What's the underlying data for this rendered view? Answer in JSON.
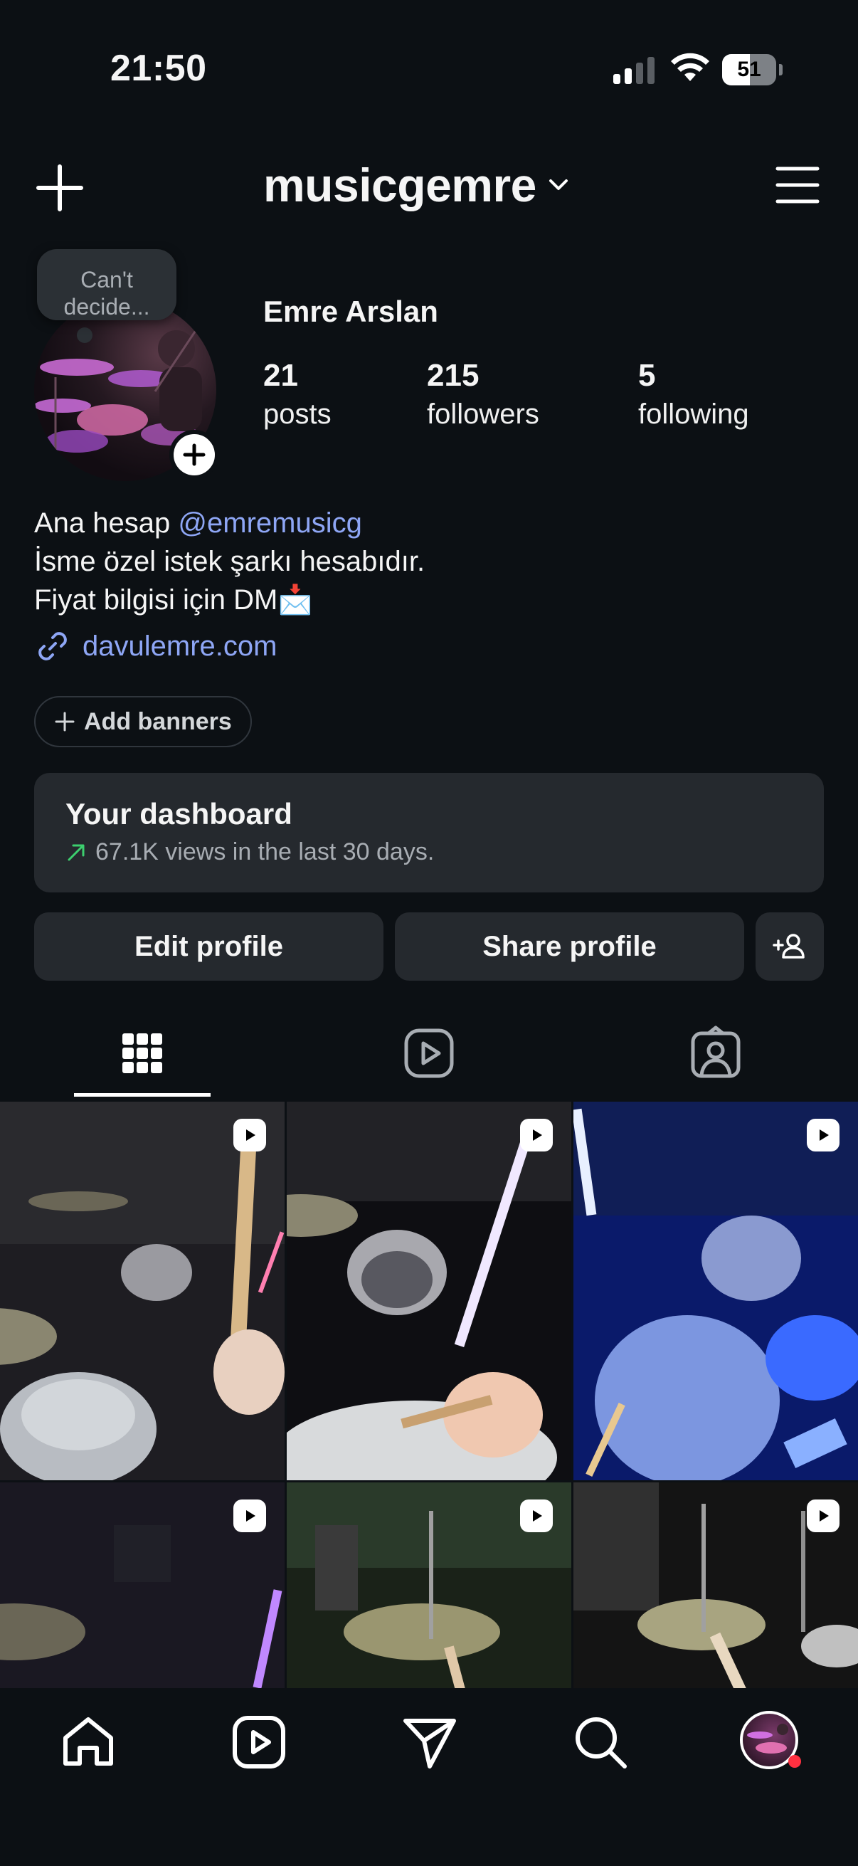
{
  "status_bar": {
    "time": "21:50",
    "battery": "51",
    "battery_level": 0.51,
    "signal_bars": 2
  },
  "header": {
    "username": "musicgemre",
    "icons": [
      "plus-icon",
      "chevron-down-icon",
      "hamburger-menu-icon"
    ]
  },
  "profile": {
    "note": "Can't decide...",
    "full_name": "Emre Arslan",
    "stats": [
      {
        "count": "21",
        "label": "posts"
      },
      {
        "count": "215",
        "label": "followers"
      },
      {
        "count": "5",
        "label": "following"
      }
    ],
    "bio": {
      "line1_prefix": "Ana hesap ",
      "line1_mention": "@emremusicg",
      "line2": "İsme özel istek şarkı hesabıdır.",
      "line3": "Fiyat bilgisi için DM📩"
    },
    "link": "davulemre.com",
    "add_banners": "Add banners"
  },
  "dashboard": {
    "title": "Your dashboard",
    "subtitle": "67.1K views in the last 30 days."
  },
  "actions": {
    "edit": "Edit profile",
    "share": "Share profile"
  },
  "tabs": [
    {
      "name": "grid",
      "icon": "grid-icon",
      "active": true
    },
    {
      "name": "reels",
      "icon": "reels-icon",
      "active": false
    },
    {
      "name": "tagged",
      "icon": "tagged-icon",
      "active": false
    }
  ],
  "posts": [
    {
      "type": "reel"
    },
    {
      "type": "reel"
    },
    {
      "type": "reel"
    },
    {
      "type": "reel"
    },
    {
      "type": "reel"
    },
    {
      "type": "reel"
    }
  ],
  "bottom_nav": [
    "home-icon",
    "reels-icon",
    "messages-icon",
    "search-icon",
    "profile-avatar"
  ],
  "colors": {
    "background": "#0c1014",
    "card": "#25292e",
    "link": "#8ea6f5",
    "trend_green": "#3ccf6e",
    "notification_dot": "#ff3040"
  }
}
